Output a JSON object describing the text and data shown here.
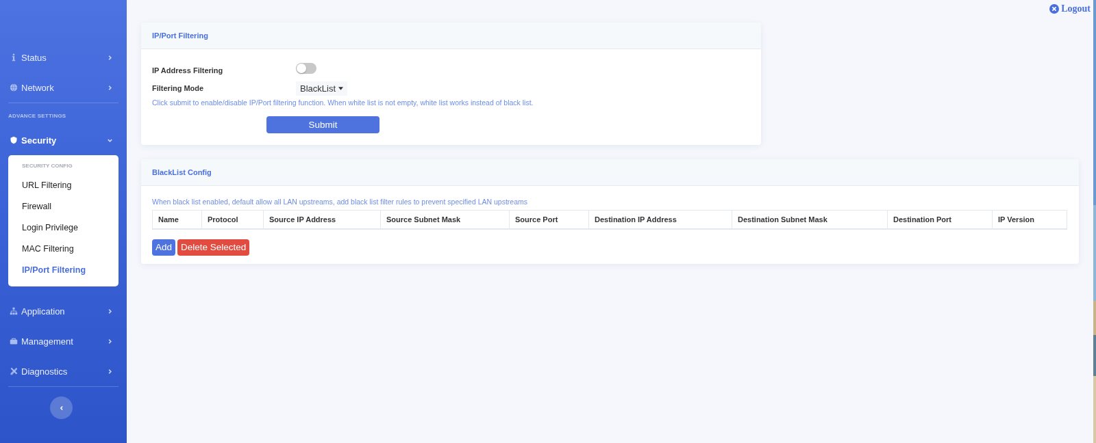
{
  "sidebar": {
    "items": [
      {
        "kind": "item",
        "label": "Status",
        "expanded": false
      },
      {
        "kind": "item",
        "label": "Network",
        "expanded": false
      },
      {
        "kind": "heading",
        "label": "ADVANCE SETTINGS"
      },
      {
        "kind": "item",
        "label": "Security",
        "expanded": true,
        "submenu": {
          "heading": "SECURITY CONFIG",
          "items": [
            {
              "label": "URL Filtering",
              "selected": false
            },
            {
              "label": "Firewall",
              "selected": false
            },
            {
              "label": "Login Privilege",
              "selected": false
            },
            {
              "label": "MAC Filtering",
              "selected": false
            },
            {
              "label": "IP/Port Filtering",
              "selected": true
            }
          ]
        }
      },
      {
        "kind": "item",
        "label": "Application",
        "expanded": false
      },
      {
        "kind": "item",
        "label": "Management",
        "expanded": false
      },
      {
        "kind": "item",
        "label": "Diagnostics",
        "expanded": false
      }
    ]
  },
  "logout": "Logout",
  "filter_card": {
    "title": "IP/Port Filtering",
    "toggle": {
      "label": "IP Address Filtering",
      "on": false
    },
    "mode": {
      "label": "Filtering Mode",
      "value": "BlackList"
    },
    "hint": "Click submit to enable/disable IP/Port filtering function. When white list is not empty, white list works instead of black list.",
    "submit": "Submit"
  },
  "list_card": {
    "title": "BlackList Config",
    "hint": "When black list enabled, default allow all LAN upstreams, add black list filter rules to prevent specified LAN upstreams",
    "table": {
      "columns": [
        "Name",
        "Protocol",
        "Source IP Address",
        "Source Subnet Mask",
        "Source Port",
        "Destination IP Address",
        "Destination Subnet Mask",
        "Destination Port",
        "IP Version"
      ]
    },
    "buttons": [
      {
        "kind": "primary",
        "label": "Add"
      },
      {
        "kind": "danger",
        "label": "Delete Selected"
      }
    ]
  }
}
